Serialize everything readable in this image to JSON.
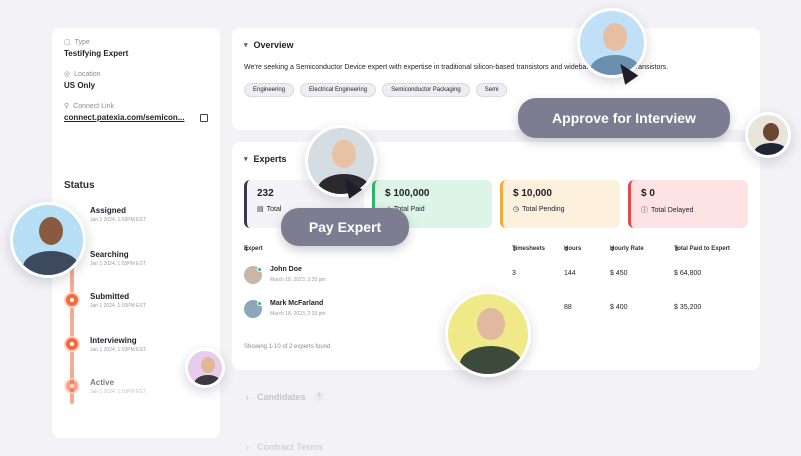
{
  "info": {
    "type_label": "Type",
    "type_value": "Testifying Expert",
    "location_label": "Location",
    "location_value": "US Only",
    "connect_label": "Connect Link",
    "connect_value": "connect.patexia.com/semicon..."
  },
  "status": {
    "title": "Status",
    "steps": [
      {
        "label": "Assigned",
        "date": "Jan 1 2024, 1:03PM EST"
      },
      {
        "label": "Searching",
        "date": "Jan 1 2024, 1:03PM EST"
      },
      {
        "label": "Submitted",
        "date": "Jan 1 2024, 1:03PM EST"
      },
      {
        "label": "Interviewing",
        "date": "Jan 1 2024, 1:03PM EST"
      },
      {
        "label": "Active",
        "date": "Jan 1 2024, 1:03PM EST"
      }
    ]
  },
  "overview": {
    "title": "Overview",
    "description": "We're seeking a Semiconductor Device expert with expertise in traditional silicon-based transistors and wideband SiC or GaN transistors.",
    "tags": [
      "Engineering",
      "Electrical Engineering",
      "Semiconductor Packaging",
      "Semi"
    ]
  },
  "experts": {
    "title": "Experts",
    "stats": [
      {
        "value": "232",
        "label": "Total"
      },
      {
        "value": "$ 100,000",
        "label": "Total Paid"
      },
      {
        "value": "$ 10,000",
        "label": "Total Pending"
      },
      {
        "value": "$ 0",
        "label": "Total Delayed"
      }
    ],
    "columns": [
      "Expert",
      "Timesheets",
      "Hours",
      "Hourly Rate",
      "Total Paid to Expert"
    ],
    "rows": [
      {
        "name": "John Doe",
        "date": "March 18, 2023, 2:33 pm",
        "timesheets": "3",
        "hours": "144",
        "rate": "$ 450",
        "total": "$ 64,800"
      },
      {
        "name": "Mark McFarland",
        "date": "March 18, 2023, 2:33 pm",
        "timesheets": "",
        "hours": "88",
        "rate": "$ 400",
        "total": "$ 35,200"
      }
    ],
    "showing": "Showing 1-10 of 2 experts found"
  },
  "candidates": {
    "title": "Candidates",
    "count": "6"
  },
  "contract": {
    "title": "Contract Terms"
  },
  "pills": {
    "approve": "Approve for Interview",
    "pay": "Pay Expert"
  },
  "colors": {
    "accent": "#f26a3d",
    "pill": "#7d7c91",
    "paid": "#2eb86a",
    "pending": "#f2a93b",
    "delayed": "#e24b4b"
  }
}
